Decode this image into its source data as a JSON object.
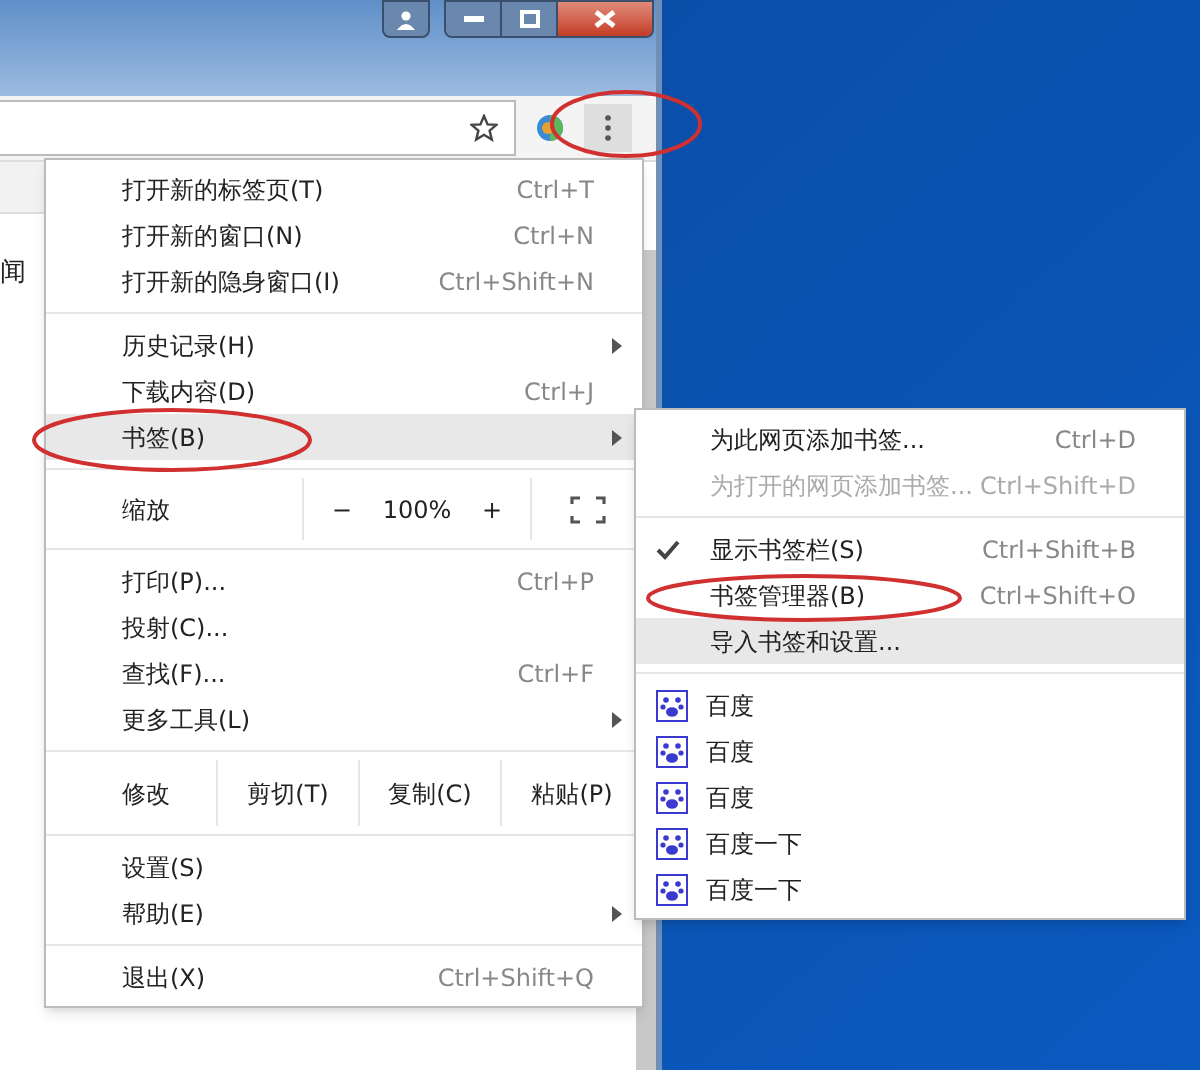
{
  "page": {
    "text_fragment": "闻"
  },
  "menu": {
    "items": [
      {
        "kind": "item",
        "label": "打开新的标签页(T)",
        "shortcut": "Ctrl+T",
        "submenu": false,
        "highlighted": false
      },
      {
        "kind": "item",
        "label": "打开新的窗口(N)",
        "shortcut": "Ctrl+N",
        "submenu": false,
        "highlighted": false
      },
      {
        "kind": "item",
        "label": "打开新的隐身窗口(I)",
        "shortcut": "Ctrl+Shift+N",
        "submenu": false,
        "highlighted": false
      },
      {
        "kind": "separator"
      },
      {
        "kind": "item",
        "label": "历史记录(H)",
        "submenu": true,
        "highlighted": false
      },
      {
        "kind": "item",
        "label": "下载内容(D)",
        "shortcut": "Ctrl+J",
        "submenu": false,
        "highlighted": false
      },
      {
        "kind": "item",
        "label": "书签(B)",
        "submenu": true,
        "highlighted": true
      },
      {
        "kind": "separator"
      },
      {
        "kind": "zoom",
        "label": "缩放",
        "minus": "−",
        "value": "100%",
        "plus": "+"
      },
      {
        "kind": "separator"
      },
      {
        "kind": "item",
        "label": "打印(P)...",
        "shortcut": "Ctrl+P",
        "submenu": false,
        "highlighted": false
      },
      {
        "kind": "item",
        "label": "投射(C)...",
        "submenu": false,
        "highlighted": false
      },
      {
        "kind": "item",
        "label": "查找(F)...",
        "shortcut": "Ctrl+F",
        "submenu": false,
        "highlighted": false
      },
      {
        "kind": "item",
        "label": "更多工具(L)",
        "submenu": true,
        "highlighted": false
      },
      {
        "kind": "separator"
      },
      {
        "kind": "edit",
        "label": "修改",
        "buttons": [
          "剪切(T)",
          "复制(C)",
          "粘贴(P)"
        ]
      },
      {
        "kind": "separator"
      },
      {
        "kind": "item",
        "label": "设置(S)",
        "submenu": false,
        "highlighted": false
      },
      {
        "kind": "item",
        "label": "帮助(E)",
        "submenu": true,
        "highlighted": false
      },
      {
        "kind": "separator"
      },
      {
        "kind": "item",
        "label": "退出(X)",
        "shortcut": "Ctrl+Shift+Q",
        "submenu": false,
        "highlighted": false
      }
    ]
  },
  "submenu": {
    "items": [
      {
        "kind": "item",
        "label": "为此网页添加书签...",
        "shortcut": "Ctrl+D",
        "disabled": false,
        "checked": false,
        "highlighted": false
      },
      {
        "kind": "item",
        "label": "为打开的网页添加书签...",
        "shortcut": "Ctrl+Shift+D",
        "disabled": true,
        "checked": false,
        "highlighted": false
      },
      {
        "kind": "separator"
      },
      {
        "kind": "item",
        "label": "显示书签栏(S)",
        "shortcut": "Ctrl+Shift+B",
        "disabled": false,
        "checked": true,
        "highlighted": false
      },
      {
        "kind": "item",
        "label": "书签管理器(B)",
        "shortcut": "Ctrl+Shift+O",
        "disabled": false,
        "checked": false,
        "highlighted": false
      },
      {
        "kind": "item",
        "label": "导入书签和设置...",
        "disabled": false,
        "checked": false,
        "highlighted": true
      },
      {
        "kind": "separator"
      },
      {
        "kind": "bookmark",
        "label": "百度"
      },
      {
        "kind": "bookmark",
        "label": "百度"
      },
      {
        "kind": "bookmark",
        "label": "百度"
      },
      {
        "kind": "bookmark",
        "label": "百度一下"
      },
      {
        "kind": "bookmark",
        "label": "百度一下"
      }
    ]
  }
}
